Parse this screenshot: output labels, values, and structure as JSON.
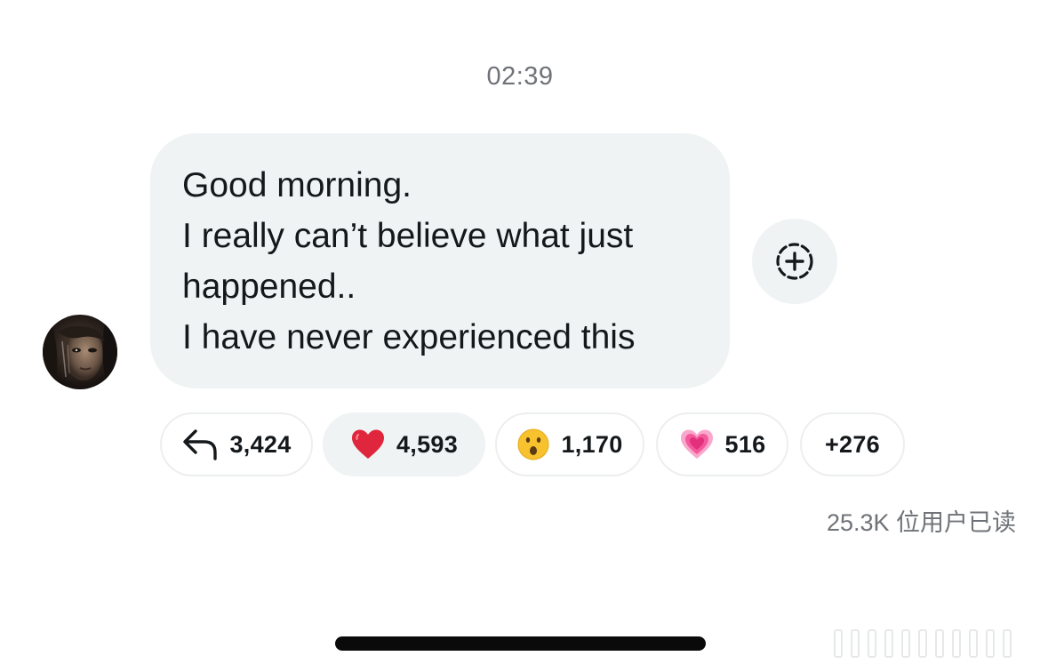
{
  "timestamp": "02:39",
  "message": {
    "lines": [
      "Good morning.",
      "I really can’t believe what just happened..",
      "I have never experienced this"
    ]
  },
  "sender": {
    "avatar_icon": "user-avatar-photo"
  },
  "add_reaction": {
    "icon": "add-reaction-icon"
  },
  "reactions": [
    {
      "icon": "reply-arrow-icon",
      "count": "3,424",
      "active": false
    },
    {
      "icon": "red-heart-emoji",
      "count": "4,593",
      "active": true
    },
    {
      "icon": "surprised-face-emoji",
      "count": "1,170",
      "active": false
    },
    {
      "icon": "growing-heart-emoji",
      "count": "516",
      "active": false
    },
    {
      "icon": "",
      "count": "+276",
      "active": false
    }
  ],
  "read_receipt": "25.3K 位用户已读",
  "colors": {
    "bubble_bg": "#eff3f4",
    "timestamp": "#6f7378",
    "heart_red": "#e0263c",
    "pink_heart": "#f45a9b"
  }
}
